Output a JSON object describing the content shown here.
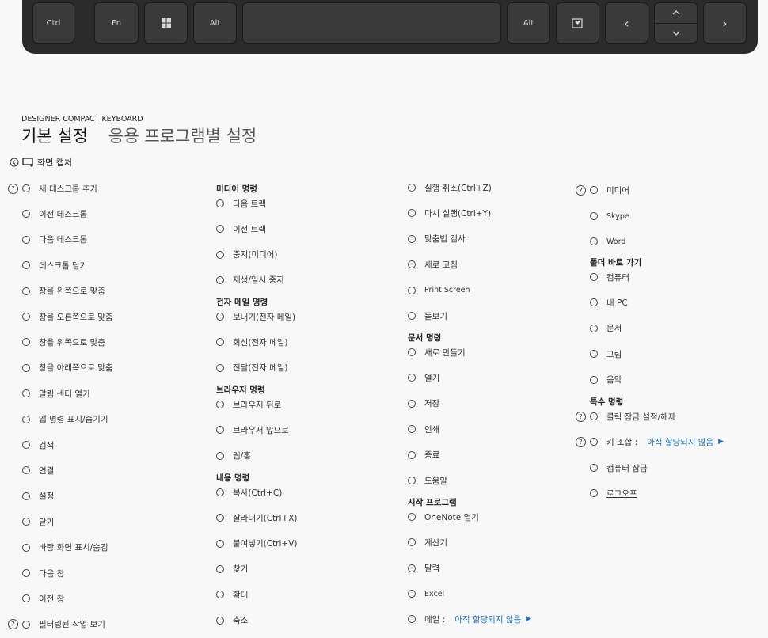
{
  "keyboard": {
    "ctrl": "Ctrl",
    "fn": "Fn",
    "win_icon": "windows-icon",
    "alt_left": "Alt",
    "alt_right": "Alt",
    "menu_icon": "heart-key-icon",
    "left": "‹",
    "up": "ˆ",
    "down": "ˇ",
    "right": "›"
  },
  "device_name": "DESIGNER COMPACT KEYBOARD",
  "tabs": {
    "basic": "기본 설정",
    "app_specific": "응용 프로그램별 설정"
  },
  "screen_capture": "화면 캡처",
  "col1": [
    {
      "label": "새 데스크톱 추가",
      "help": true
    },
    {
      "label": "이전 데스크톱"
    },
    {
      "label": "다음 데스크톱"
    },
    {
      "label": "데스크톱 닫기"
    },
    {
      "label": "창을 왼쪽으로 맞춤"
    },
    {
      "label": "창을 오른쪽으로 맞춤"
    },
    {
      "label": "창을 위쪽으로 맞춤"
    },
    {
      "label": "창을 아래쪽으로 맞춤"
    },
    {
      "label": "알림 센터 열기"
    },
    {
      "label": "앱 명령 표시/숨기기"
    },
    {
      "label": "검색"
    },
    {
      "label": "연결"
    },
    {
      "label": "설정"
    },
    {
      "label": "닫기"
    },
    {
      "label": "바탕 화면 표시/숨김"
    },
    {
      "label": "다음 창"
    },
    {
      "label": "이전 창"
    },
    {
      "label": "필터링된 작업 보기",
      "help": true
    }
  ],
  "col2": {
    "media_header": "미디어 명령",
    "media": [
      "다음 트랙",
      "이전 트랙",
      "중지(미디어)",
      "재생/일시 중지"
    ],
    "email_header": "전자 메일 명령",
    "email": [
      "보내기(전자 메일)",
      "회신(전자 메일)",
      "전달(전자 메일)"
    ],
    "browser_header": "브라우저 명령",
    "browser": [
      "브라우저 뒤로",
      "브라우저 앞으로",
      "웹/홈"
    ],
    "content_header": "내용 명령",
    "content": [
      "복사(Ctrl+C)",
      "잘라내기(Ctrl+X)",
      "붙여넣기(Ctrl+V)",
      "찾기",
      "확대",
      "축소"
    ]
  },
  "col3": {
    "edit": [
      "실행 취소(Ctrl+Z)",
      "다시 실행(Ctrl+Y)",
      "맞춤법 검사",
      "새로 고침",
      "Print Screen",
      "돋보기"
    ],
    "doc_header": "문서 명령",
    "doc": [
      "새로 만들기",
      "열기",
      "저장",
      "인쇄",
      "종료",
      "도움말"
    ],
    "start_header": "시작 프로그램",
    "start": [
      "OneNote 열기",
      "계산기",
      "달력",
      "Excel"
    ],
    "mail_label": "메일 :",
    "mail_value": "아직 할당되지 않음"
  },
  "col4": {
    "media_item": "미디어",
    "media_sub": [
      "Skype",
      "Word"
    ],
    "folder_header": "폴더 바로 가기",
    "folders": [
      "컴퓨터",
      "내 PC",
      "문서",
      "그림",
      "음악"
    ],
    "special_header": "특수 명령",
    "clicklock": "클릭 잠금 설정/해제",
    "combo_label": "키 조합 :",
    "combo_value": "아직 할당되지 않음",
    "lock": "컴퓨터 잠금",
    "logoff": "로그오프"
  }
}
